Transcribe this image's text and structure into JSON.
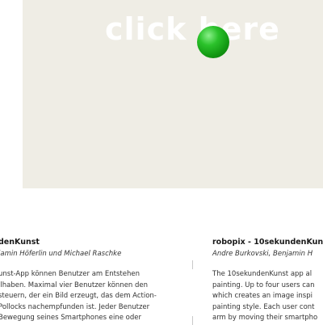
{
  "stage": {
    "cta_text": "click here",
    "background_color": "#efede5",
    "ball_color": "#1fae1f"
  },
  "left_column": {
    "title": "denKunst",
    "authors": "jamin Höferlin und Michael Raschke",
    "body_lines": [
      "unst-App können Benutzer am Entstehen",
      "ilhaben. Maximal vier Benutzer können den",
      "steuern, der ein Bild erzeugt, das dem Action-",
      "Pollocks nachempfunden ist. Jeder Benutzer",
      "Bewegung seines Smartphones eine oder"
    ]
  },
  "right_column": {
    "title": "robopix - 10sekundenKun",
    "authors": "Andre Burkovski, Benjamin H",
    "body_lines": [
      "The 10sekundenKunst app al",
      "painting. Up to four users can",
      "which creates an image inspi",
      "painting style. Each user cont",
      "arm by moving their smartpho"
    ]
  }
}
